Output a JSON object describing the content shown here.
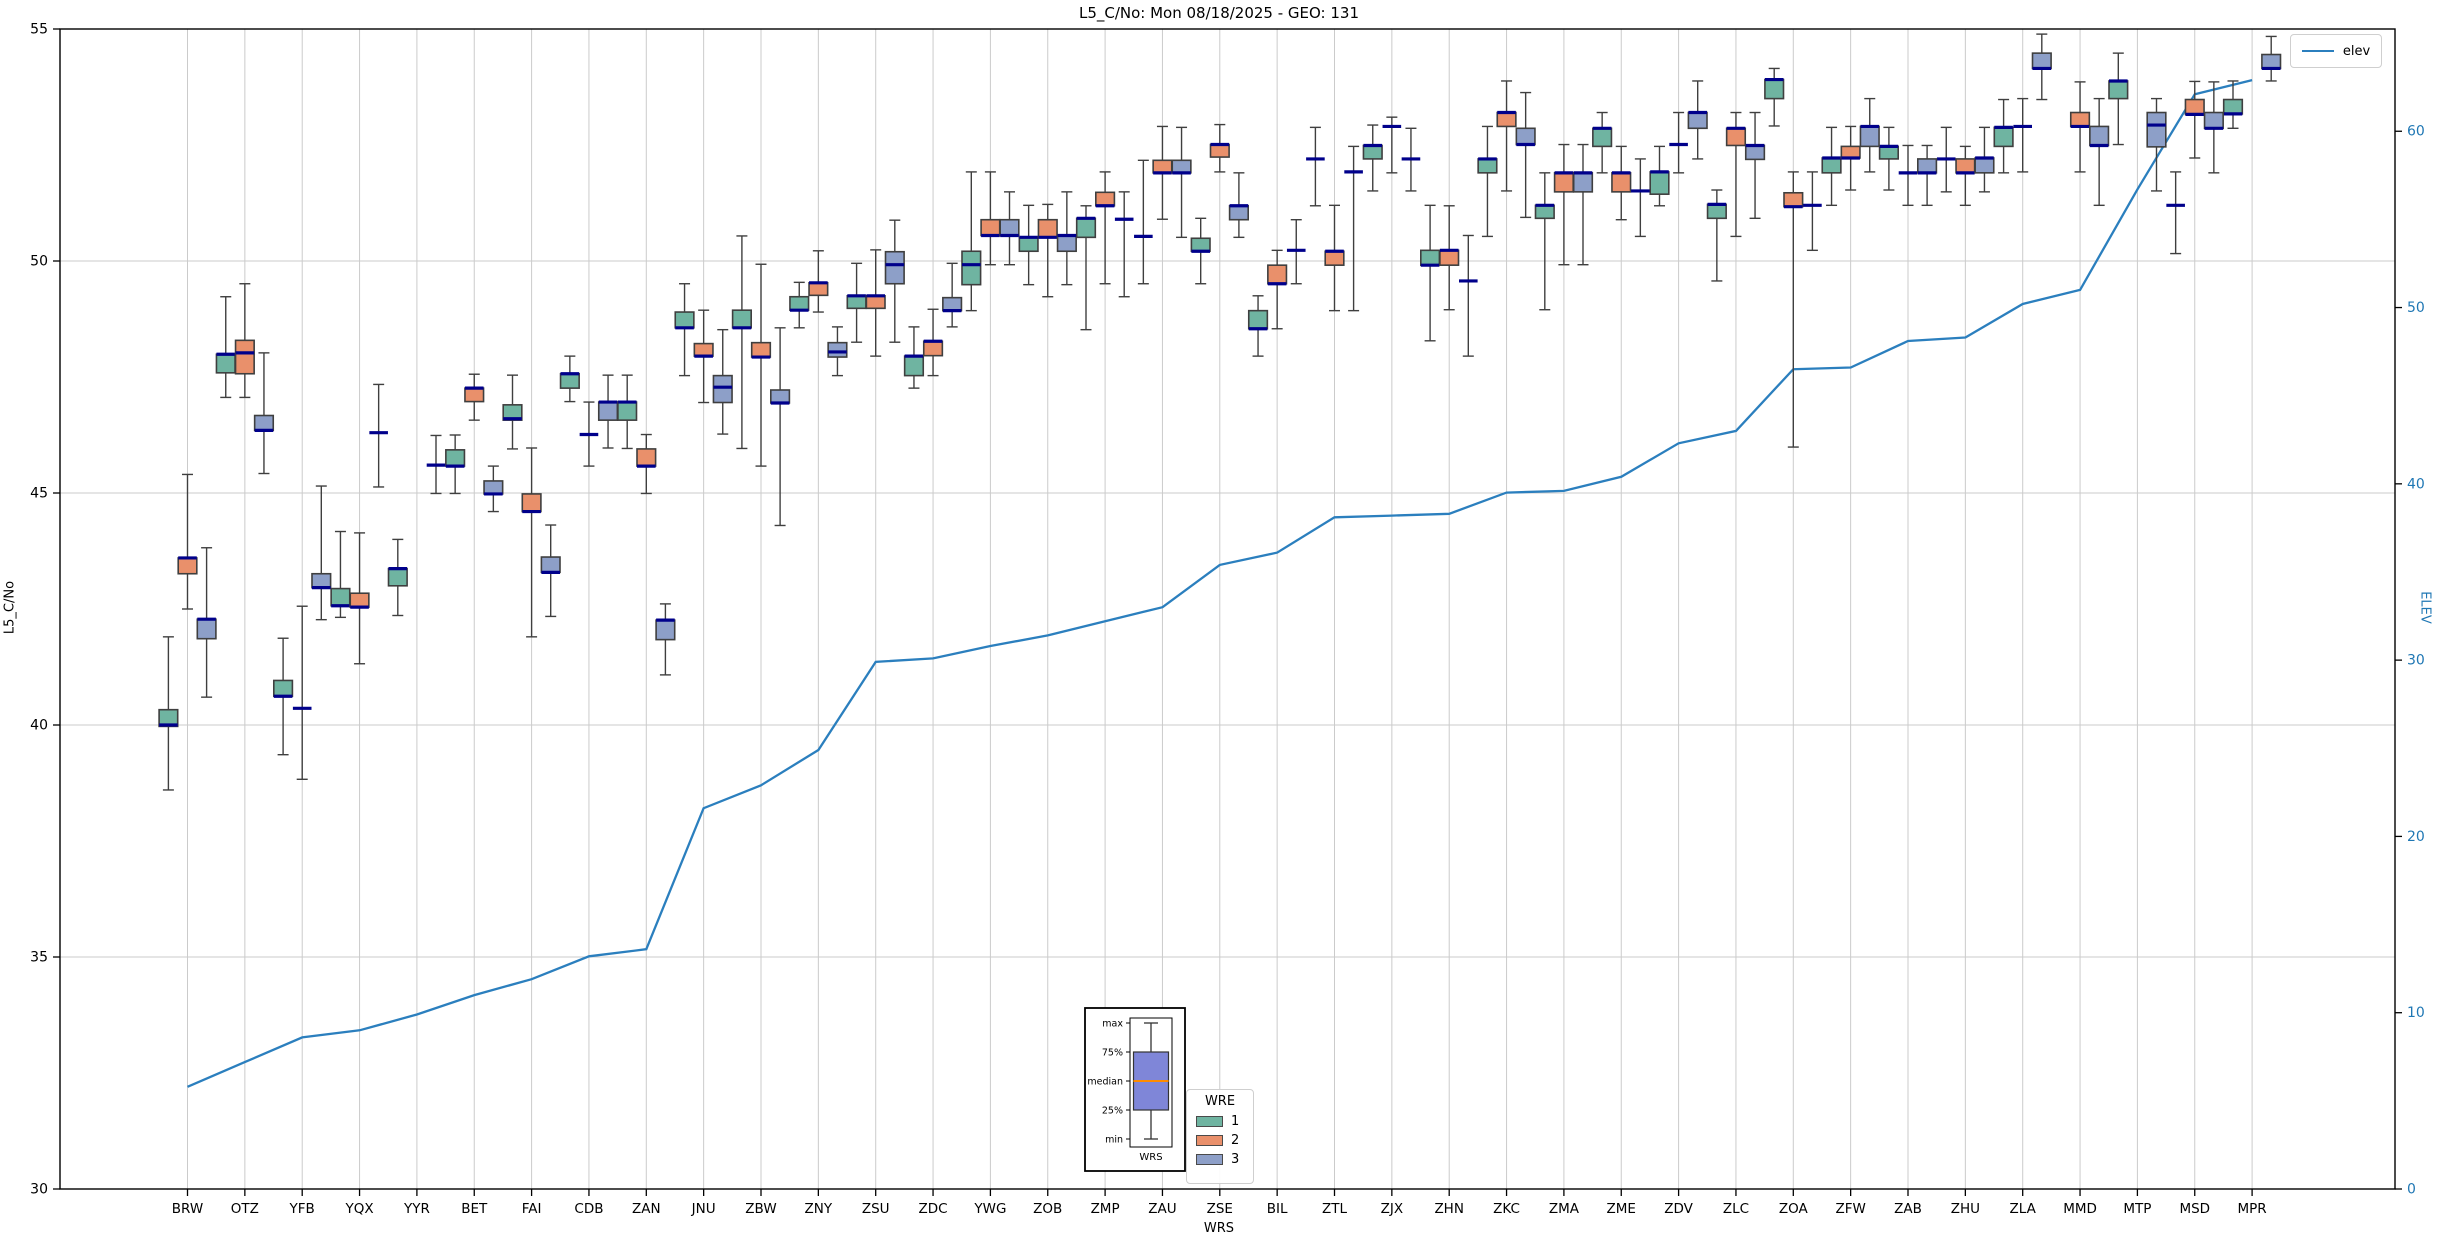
{
  "title": "L5_C/No: Mon 08/18/2025 - GEO: 131",
  "axes": {
    "ylabel_left": "L5_C/No",
    "ylabel_right": "ELEV",
    "xlabel": "WRS"
  },
  "legend_elev": {
    "label": "elev"
  },
  "legend_wre": {
    "title": "WRE",
    "entries": [
      {
        "label": "1",
        "color": "#6fb4a1"
      },
      {
        "label": "2",
        "color": "#e9906b"
      },
      {
        "label": "3",
        "color": "#8d9fc8"
      }
    ]
  },
  "inset": {
    "labels": [
      "max",
      "75%",
      "median",
      "25%",
      "min"
    ],
    "xlabel": "WRS"
  },
  "chart_data": {
    "type": "grouped-boxplot+line",
    "title": "L5_C/No: Mon 08/18/2025 - GEO: 131",
    "xlabel": "WRS",
    "ylabel_left": "L5_C/No",
    "ylabel_right": "ELEV",
    "grid": true,
    "ylim_left": [
      30,
      55
    ],
    "yticks_left": [
      30,
      35,
      40,
      45,
      50,
      55
    ],
    "ylim_right": [
      0,
      65.8
    ],
    "yticks_right": [
      0,
      10,
      20,
      30,
      40,
      50,
      60
    ],
    "colors": {
      "wre1": "#6fb4a1",
      "wre2": "#e9906b",
      "wre3": "#8d9fc8",
      "median": "#00008b",
      "box_edge": "#3f3f3f",
      "whisker": "#3f3f3f",
      "elev_line": "#2b7fbe",
      "grid": "#cbcbcb",
      "spine": "#000000",
      "right_axis_text": "#1f77b4",
      "inset_box_fill": "#7f86d8",
      "inset_median": "#ff8c00"
    },
    "legend": {
      "elev": "elev",
      "wre_title": "WRE",
      "wre_labels": [
        "1",
        "2",
        "3"
      ]
    },
    "stations": [
      "BRW",
      "OTZ",
      "YFB",
      "YQX",
      "YYR",
      "BET",
      "FAI",
      "CDB",
      "ZAN",
      "JNU",
      "ZBW",
      "ZNY",
      "ZSU",
      "ZDC",
      "YWG",
      "ZOB",
      "ZMP",
      "ZAU",
      "ZSE",
      "BIL",
      "ZTL",
      "ZJX",
      "ZHN",
      "ZKC",
      "ZMA",
      "ZME",
      "ZDV",
      "ZLC",
      "ZOA",
      "ZFW",
      "ZAB",
      "ZHU",
      "ZLA",
      "MMD",
      "MTP",
      "MSD",
      "MPR"
    ],
    "elev": [
      5.8,
      7.2,
      8.6,
      9.0,
      9.9,
      11.0,
      11.9,
      13.2,
      13.6,
      21.6,
      22.9,
      24.9,
      29.9,
      30.1,
      30.8,
      31.4,
      32.2,
      33.0,
      35.4,
      36.1,
      38.1,
      38.2,
      38.3,
      39.5,
      39.6,
      40.4,
      42.3,
      43.0,
      46.5,
      46.6,
      48.1,
      48.3,
      50.2,
      51.0,
      56.7,
      62.1,
      62.9
    ],
    "boxes_format": [
      "whisker_low",
      "q1",
      "median",
      "q3",
      "whisker_high"
    ],
    "series": {
      "1": [
        [
          38.6,
          39.97,
          40.0,
          40.33,
          41.9
        ],
        [
          47.06,
          47.59,
          47.99,
          47.99,
          49.23
        ],
        [
          39.36,
          40.62,
          40.62,
          40.96,
          41.87
        ],
        [
          42.32,
          42.57,
          42.57,
          42.94,
          44.17
        ],
        [
          42.36,
          43.0,
          43.37,
          43.37,
          44.0
        ],
        [
          44.99,
          45.58,
          45.58,
          45.93,
          46.25
        ],
        [
          45.95,
          46.57,
          46.6,
          46.9,
          47.54
        ],
        [
          46.97,
          47.26,
          47.57,
          47.57,
          47.95
        ],
        [
          45.96,
          46.57,
          46.96,
          46.96,
          47.54
        ],
        [
          47.53,
          48.56,
          48.56,
          48.9,
          49.51
        ],
        [
          45.96,
          48.56,
          48.56,
          48.94,
          50.54
        ],
        [
          48.56,
          48.94,
          48.94,
          49.23,
          49.54
        ],
        [
          48.25,
          48.98,
          49.25,
          49.25,
          49.95
        ],
        [
          47.26,
          47.53,
          47.95,
          47.95,
          48.58
        ],
        [
          48.93,
          49.49,
          49.92,
          50.21,
          51.92
        ],
        [
          49.49,
          50.21,
          50.51,
          50.51,
          51.2
        ],
        [
          48.52,
          50.51,
          50.92,
          50.92,
          51.19
        ],
        [
          49.51,
          50.53,
          50.53,
          50.53,
          52.17
        ],
        [
          49.51,
          50.21,
          50.21,
          50.49,
          50.92
        ],
        [
          47.95,
          48.54,
          48.54,
          48.93,
          49.25
        ],
        [
          51.19,
          52.2,
          52.2,
          52.2,
          52.88
        ],
        [
          51.51,
          52.2,
          52.49,
          52.49,
          52.93
        ],
        [
          48.28,
          49.91,
          49.91,
          50.23,
          51.2
        ],
        [
          50.53,
          51.9,
          52.2,
          52.2,
          52.9
        ],
        [
          48.95,
          50.92,
          51.2,
          51.2,
          51.9
        ],
        [
          51.9,
          52.47,
          52.86,
          52.86,
          53.2
        ],
        [
          51.19,
          51.44,
          51.92,
          51.92,
          52.47
        ],
        [
          49.57,
          50.92,
          51.22,
          51.22,
          51.53
        ],
        [
          52.91,
          53.5,
          53.91,
          53.91,
          54.15
        ],
        [
          51.2,
          51.9,
          52.22,
          52.22,
          52.88
        ],
        [
          51.53,
          52.2,
          52.47,
          52.47,
          52.88
        ],
        [
          51.49,
          52.2,
          52.2,
          52.2,
          52.88
        ],
        [
          51.9,
          52.47,
          52.88,
          52.88,
          53.48
        ],
        null,
        [
          52.51,
          53.5,
          53.88,
          53.88,
          54.48
        ],
        [
          50.16,
          51.2,
          51.2,
          51.2,
          51.92
        ],
        [
          52.86,
          53.17,
          53.17,
          53.48,
          53.88
        ]
      ],
      "2": [
        [
          42.5,
          43.26,
          43.6,
          43.6,
          45.4
        ],
        [
          47.06,
          47.57,
          48.02,
          48.29,
          49.51
        ],
        [
          38.83,
          40.36,
          40.36,
          40.36,
          42.56
        ],
        [
          41.32,
          42.54,
          42.54,
          42.84,
          44.14
        ],
        null,
        [
          46.57,
          46.97,
          47.26,
          47.26,
          47.56
        ],
        [
          41.9,
          44.6,
          44.6,
          44.98,
          45.97
        ],
        [
          45.58,
          46.26,
          46.26,
          46.26,
          46.96
        ],
        [
          44.99,
          45.58,
          45.58,
          45.95,
          46.26
        ],
        [
          46.95,
          47.95,
          47.95,
          48.22,
          48.94
        ],
        [
          45.58,
          47.93,
          47.93,
          48.24,
          49.93
        ],
        [
          48.9,
          49.26,
          49.53,
          49.53,
          50.22
        ],
        [
          47.95,
          48.98,
          49.25,
          49.25,
          50.24
        ],
        [
          47.53,
          47.96,
          48.27,
          48.27,
          48.96
        ],
        [
          49.92,
          50.55,
          50.55,
          50.89,
          51.92
        ],
        [
          49.23,
          50.51,
          50.51,
          50.89,
          51.22
        ],
        [
          49.51,
          51.19,
          51.19,
          51.48,
          51.92
        ],
        [
          50.9,
          51.9,
          51.9,
          52.17,
          52.9
        ],
        [
          51.92,
          52.24,
          52.51,
          52.51,
          52.94
        ],
        [
          48.54,
          49.51,
          49.51,
          49.91,
          50.23
        ],
        [
          48.93,
          49.91,
          50.21,
          50.21,
          51.2
        ],
        [
          51.9,
          52.9,
          52.9,
          52.9,
          53.1
        ],
        [
          48.95,
          49.91,
          50.23,
          50.23,
          51.19
        ],
        [
          51.51,
          52.9,
          53.2,
          53.2,
          53.88
        ],
        [
          49.92,
          51.49,
          51.9,
          51.9,
          52.51
        ],
        [
          50.89,
          51.49,
          51.9,
          51.9,
          52.47
        ],
        [
          51.9,
          52.51,
          52.51,
          52.51,
          53.2
        ],
        [
          50.53,
          52.49,
          52.86,
          52.86,
          53.2
        ],
        [
          45.99,
          51.17,
          51.17,
          51.47,
          51.92
        ],
        [
          51.53,
          52.22,
          52.22,
          52.47,
          52.9
        ],
        [
          51.2,
          51.9,
          51.9,
          51.9,
          52.49
        ],
        [
          51.2,
          51.9,
          51.9,
          52.2,
          52.47
        ],
        [
          51.92,
          52.9,
          52.9,
          52.9,
          53.5
        ],
        [
          51.92,
          52.9,
          52.9,
          53.2,
          53.86
        ],
        null,
        [
          52.22,
          53.16,
          53.16,
          53.48,
          53.87
        ],
        null
      ],
      "3": [
        [
          40.6,
          41.86,
          42.28,
          42.28,
          43.82
        ],
        [
          45.42,
          46.35,
          46.35,
          46.67,
          48.02
        ],
        [
          42.27,
          42.96,
          42.96,
          43.26,
          45.15
        ],
        [
          45.13,
          46.3,
          46.3,
          46.3,
          47.34
        ],
        [
          44.99,
          45.6,
          45.6,
          45.6,
          46.24
        ],
        [
          44.6,
          44.98,
          44.98,
          45.26,
          45.58
        ],
        [
          42.34,
          43.29,
          43.29,
          43.62,
          44.31
        ],
        [
          45.97,
          46.57,
          46.96,
          46.96,
          47.54
        ],
        [
          41.08,
          41.84,
          42.26,
          42.26,
          42.61
        ],
        [
          46.27,
          46.95,
          47.28,
          47.53,
          48.52
        ],
        [
          44.3,
          46.94,
          46.94,
          47.22,
          48.56
        ],
        [
          47.53,
          47.93,
          48.04,
          48.24,
          48.58
        ],
        [
          48.25,
          49.51,
          49.92,
          50.2,
          50.88
        ],
        [
          48.58,
          48.93,
          48.93,
          49.21,
          49.95
        ],
        [
          49.92,
          50.55,
          50.55,
          50.89,
          51.49
        ],
        [
          49.49,
          50.21,
          50.55,
          50.55,
          51.49
        ],
        [
          49.23,
          50.9,
          50.9,
          50.9,
          51.49
        ],
        [
          50.51,
          51.9,
          51.9,
          52.17,
          52.88
        ],
        [
          50.51,
          50.89,
          51.19,
          51.19,
          51.9
        ],
        [
          49.51,
          50.23,
          50.23,
          50.23,
          50.89
        ],
        [
          48.93,
          51.92,
          51.92,
          51.92,
          52.47
        ],
        [
          51.51,
          52.2,
          52.2,
          52.2,
          52.86
        ],
        [
          47.95,
          49.57,
          49.57,
          49.57,
          50.55
        ],
        [
          50.94,
          52.51,
          52.51,
          52.86,
          53.63
        ],
        [
          49.92,
          51.49,
          51.9,
          51.9,
          52.51
        ],
        [
          50.53,
          51.51,
          51.51,
          51.51,
          52.2
        ],
        [
          52.2,
          52.86,
          53.2,
          53.2,
          53.88
        ],
        [
          50.92,
          52.19,
          52.49,
          52.49,
          53.2
        ],
        [
          50.23,
          51.2,
          51.2,
          51.2,
          51.92
        ],
        [
          51.92,
          52.47,
          52.9,
          52.9,
          53.5
        ],
        [
          51.2,
          51.9,
          51.9,
          52.2,
          52.49
        ],
        [
          51.49,
          51.9,
          52.22,
          52.22,
          52.88
        ],
        [
          53.48,
          54.15,
          54.15,
          54.48,
          54.89
        ],
        [
          51.2,
          52.49,
          52.49,
          52.9,
          53.5
        ],
        [
          51.51,
          52.46,
          52.93,
          53.2,
          53.5
        ],
        [
          51.9,
          52.86,
          52.86,
          53.2,
          53.86
        ],
        [
          53.88,
          54.15,
          54.15,
          54.45,
          54.84
        ]
      ]
    }
  }
}
